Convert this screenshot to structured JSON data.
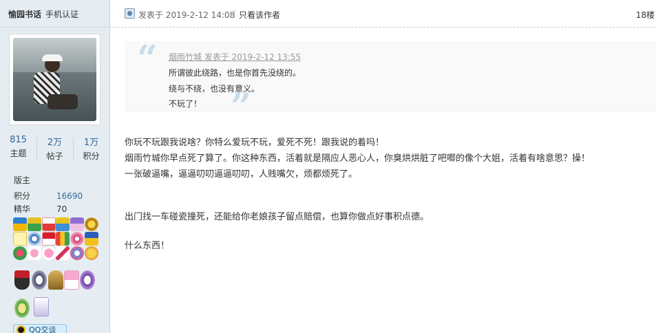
{
  "user": {
    "name": "愉园书话",
    "verification": "手机认证",
    "stats": [
      {
        "value": "815",
        "label": "主题"
      },
      {
        "value": "2万",
        "label": "帖子"
      },
      {
        "value": "1万",
        "label": "积分"
      }
    ],
    "rank": "版主",
    "points_label": "积分",
    "points_value": "16690",
    "digest_label": "精华",
    "digest_value": "70",
    "qq_label": "QQ交谈"
  },
  "post": {
    "posted_at": "发表于 2019-2-12 14:08",
    "author_only": "只看该作者",
    "floor": "18楼",
    "quote": {
      "author_line": "烟雨竹城 发表于 2019-2-12 13:55",
      "lines": [
        "所谓彼此绕路，也是你首先没绕的。",
        "绕与不绕，也没有意义。",
        "不玩了！"
      ]
    },
    "content_lines": [
      "你玩不玩跟我说啥？你特么爱玩不玩，爱死不死！跟我说的着吗！",
      "烟雨竹城你早点死了算了。你这种东西，活着就是隔应人恶心人，你臭烘烘脏了吧唧的像个大姐，活着有啥意思？操！",
      "一张破逼嘴，逼逼叨叨逼逼叨叨，人贱嘴欠，烦都烦死了。",
      "出门找一车碰瓷撞死，还能给你老娘孩子留点赔偿，也算你做点好事积点德。",
      "什么东西！"
    ]
  },
  "colors": {
    "sidebar_bg": "#e5edf2",
    "link_blue": "#336699",
    "quote_mark": "#c8dde9"
  }
}
